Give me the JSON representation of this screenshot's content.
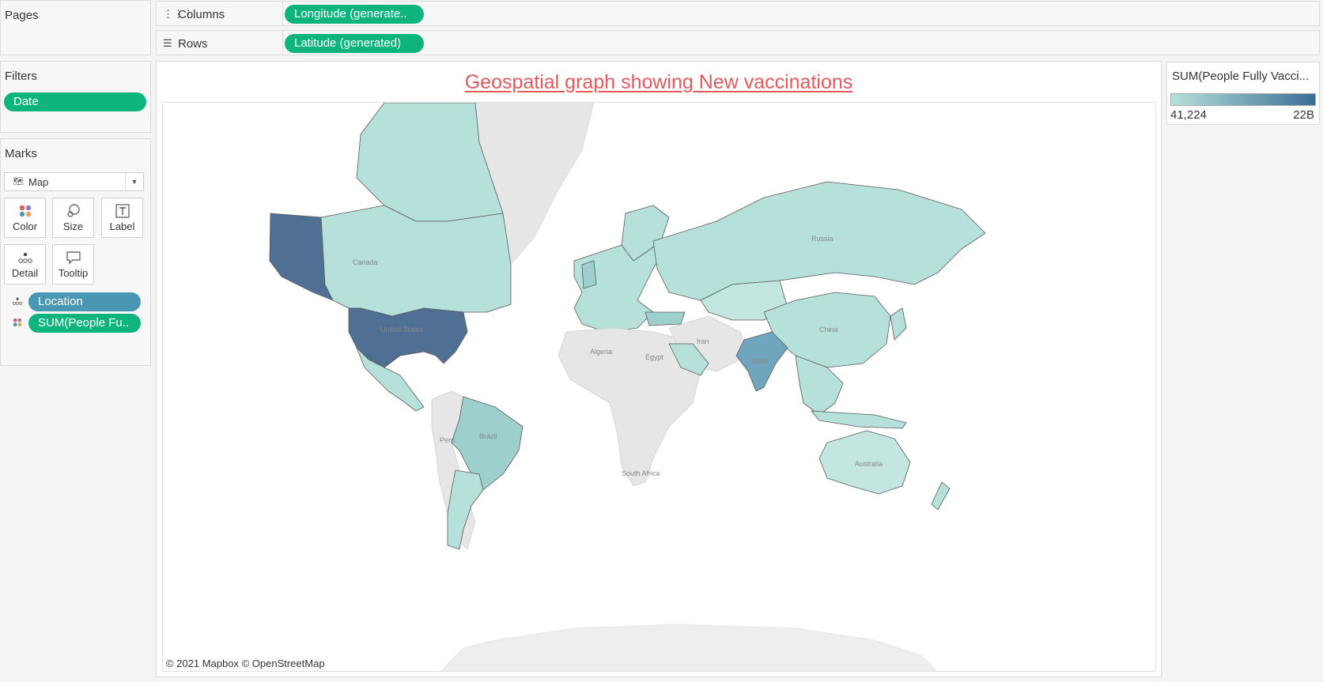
{
  "pages": {
    "title": "Pages"
  },
  "columns": {
    "label": "Columns",
    "pill": "Longitude (generate.."
  },
  "rows": {
    "label": "Rows",
    "pill": "Latitude (generated)"
  },
  "filters": {
    "title": "Filters",
    "pill": "Date"
  },
  "marks": {
    "title": "Marks",
    "type": "Map",
    "cards": {
      "color": "Color",
      "size": "Size",
      "label": "Label",
      "detail": "Detail",
      "tooltip": "Tooltip"
    },
    "fields": {
      "location": "Location",
      "sum": "SUM(People Fu.."
    }
  },
  "view": {
    "title": "Geospatial graph showing New vaccinations",
    "attribution": "© 2021 Mapbox © OpenStreetMap",
    "map_labels": {
      "canada": "Canada",
      "us": "United States",
      "brazil": "Brazil",
      "peru": "Peru",
      "algeria": "Algeria",
      "egypt": "Egypt",
      "iran": "Iran",
      "india": "India",
      "china": "China",
      "russia": "Russia",
      "australia": "Australia",
      "south_africa": "South Africa"
    }
  },
  "legend": {
    "title": "SUM(People Fully Vacci...",
    "min": "41,224",
    "max": "22B"
  },
  "colors": {
    "pill_green": "#0db47e",
    "pill_blue": "#4a97b5",
    "title_red": "#e8585b",
    "scale_low": "#b6e0da",
    "scale_high": "#3c6e96",
    "land_no_data": "#e6e6e6"
  }
}
